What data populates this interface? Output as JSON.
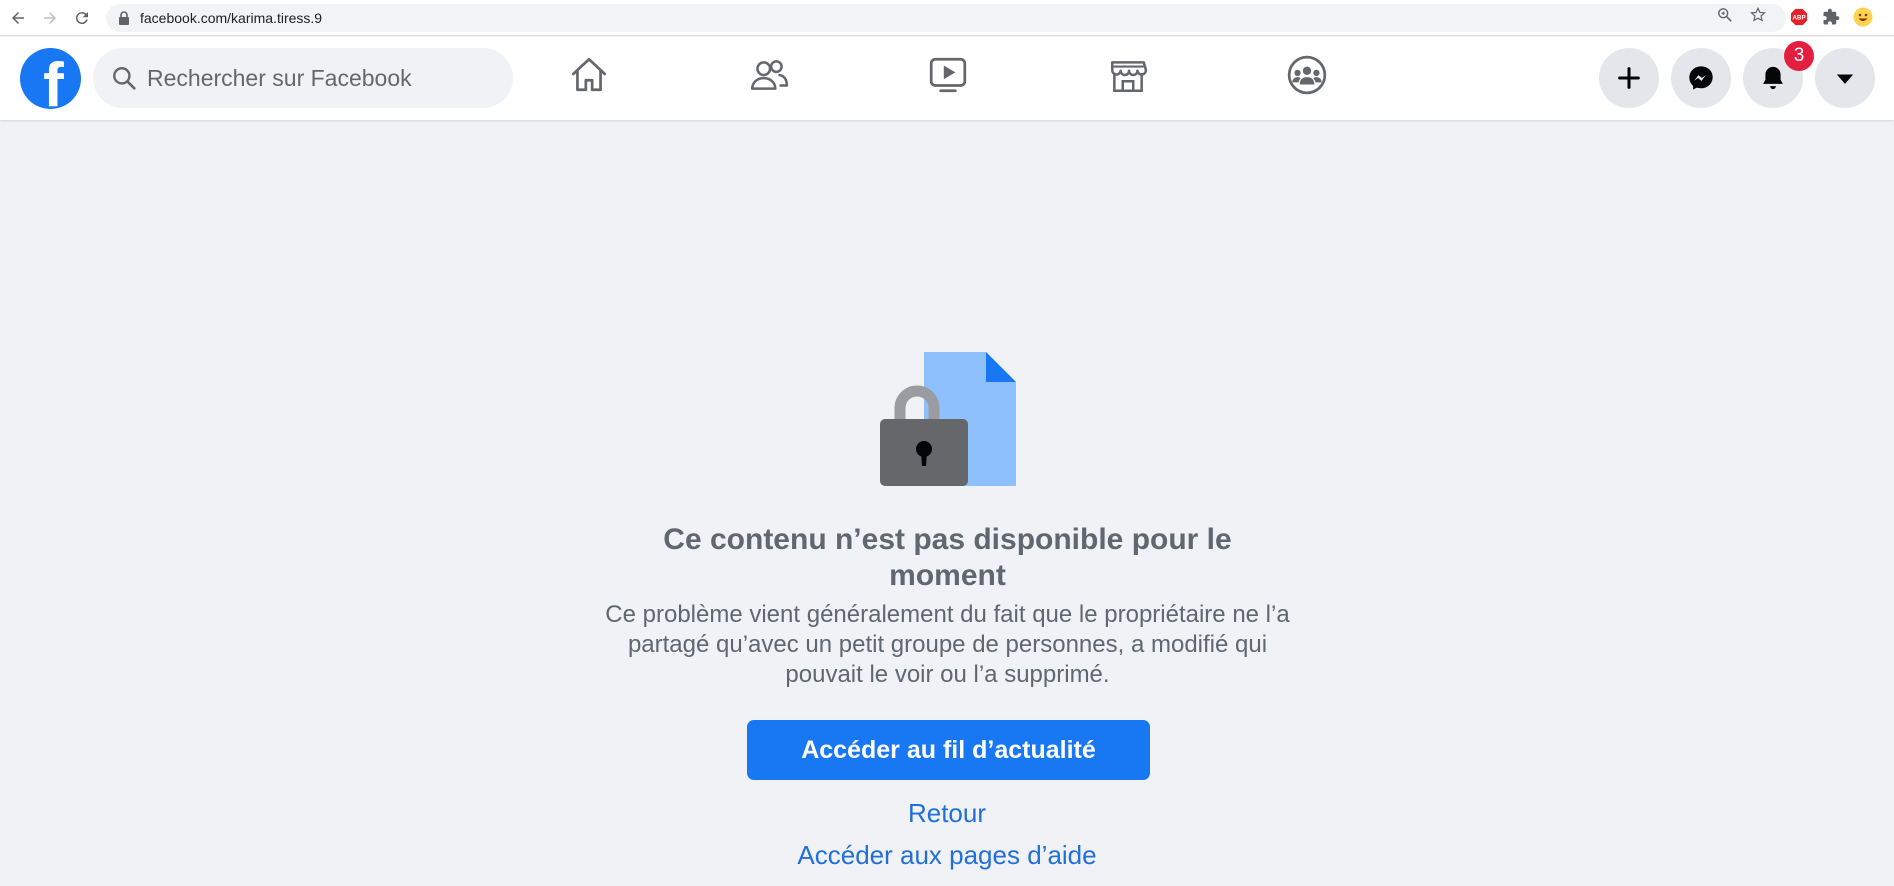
{
  "browser": {
    "url": "facebook.com/karima.tiress.9",
    "extension_abp_label": "ABP"
  },
  "header": {
    "logo_letter": "f",
    "search_placeholder": "Rechercher sur Facebook",
    "notifications_count": "3",
    "brand_color": "#1877f2"
  },
  "content": {
    "title": "Ce contenu n’est pas disponible pour le moment",
    "description": "Ce problème vient généralement du fait que le propriétaire ne l’a partagé qu’avec un petit groupe de personnes, a modifié qui pouvait le voir ou l’a supprimé.",
    "primary_button": "Accéder au fil d’actualité",
    "back_link": "Retour",
    "help_link": "Accéder aux pages d’aide"
  }
}
